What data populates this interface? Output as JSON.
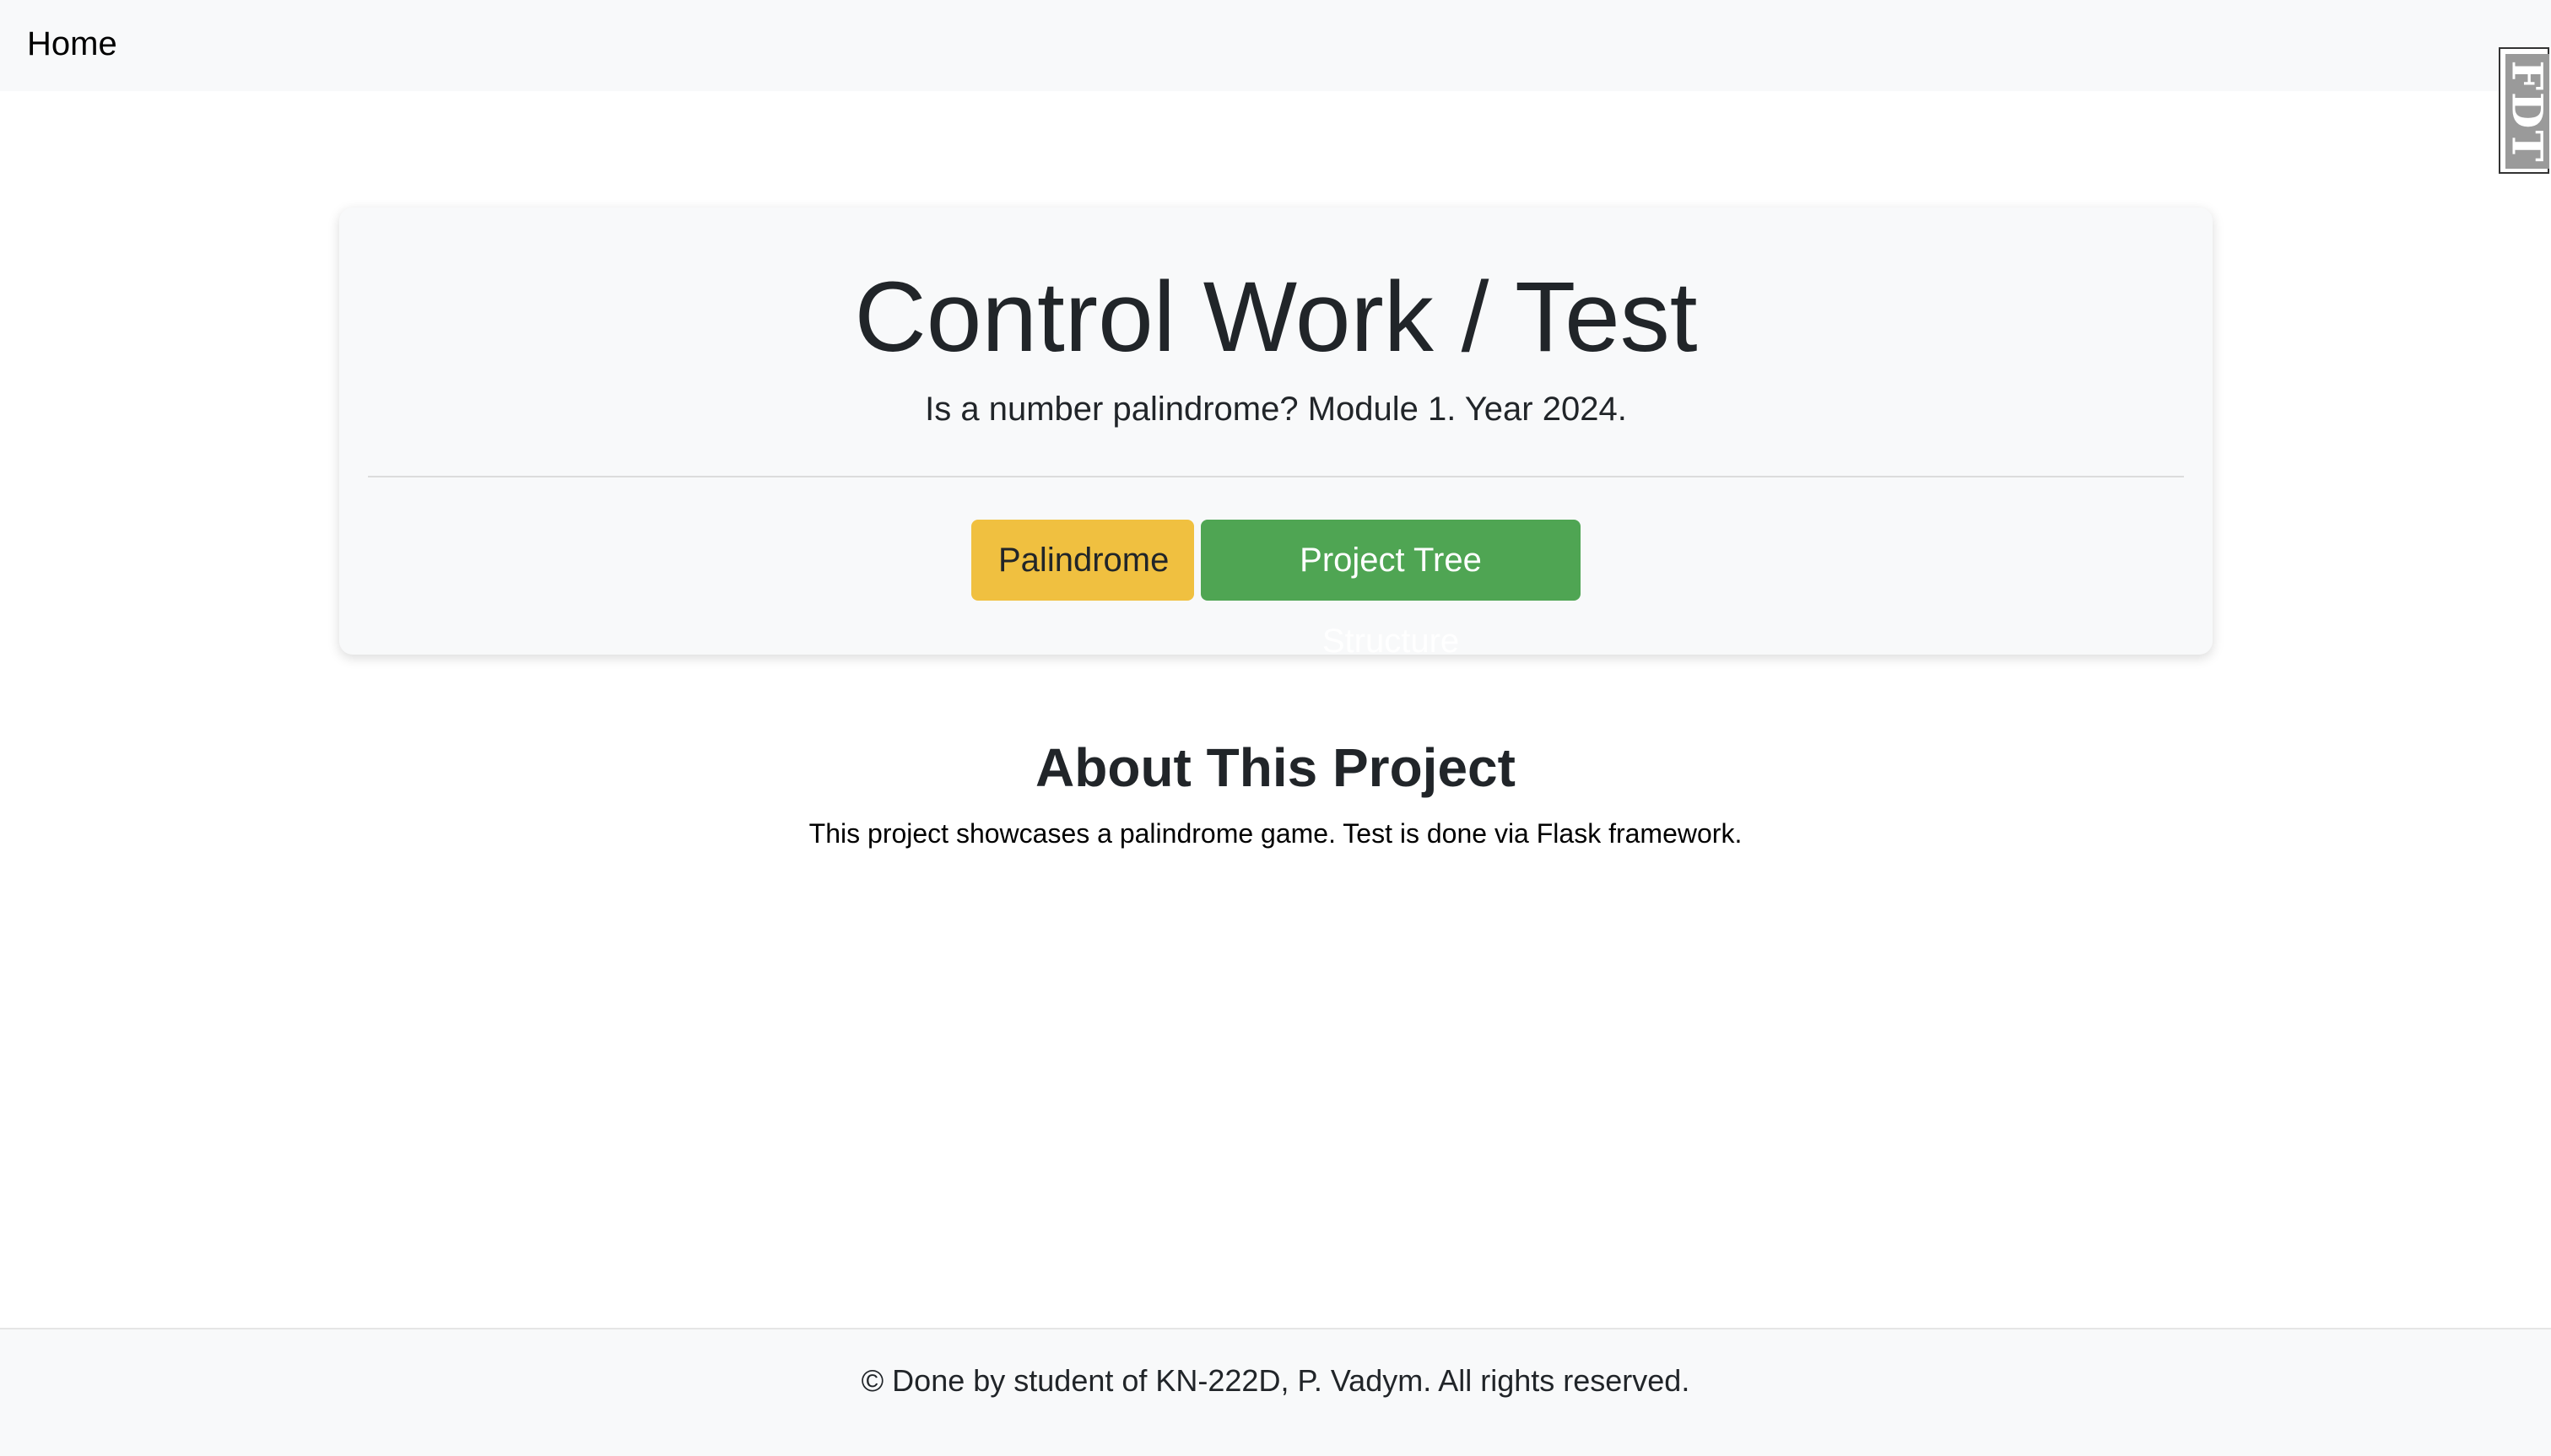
{
  "navbar": {
    "home_label": "Home"
  },
  "fdt_handle": {
    "label": "FDT"
  },
  "hero": {
    "title": "Control Work / Test",
    "lead": "Is a number palindrome? Module 1. Year 2024.",
    "buttons": [
      {
        "label": "Palindrome",
        "color": "#f0c040"
      },
      {
        "label": "Project Tree Structure",
        "color": "#4fa553"
      }
    ]
  },
  "about": {
    "title": "About This Project",
    "text": "This project showcases a palindrome game. Test is done via Flask framework."
  },
  "footer": {
    "text": "© Done by student of KN-222D, P. Vadym. All rights reserved."
  },
  "colors": {
    "navbar_bg": "#f8f9fa",
    "warning": "#f0c040",
    "success": "#4fa553",
    "text": "#212529"
  }
}
